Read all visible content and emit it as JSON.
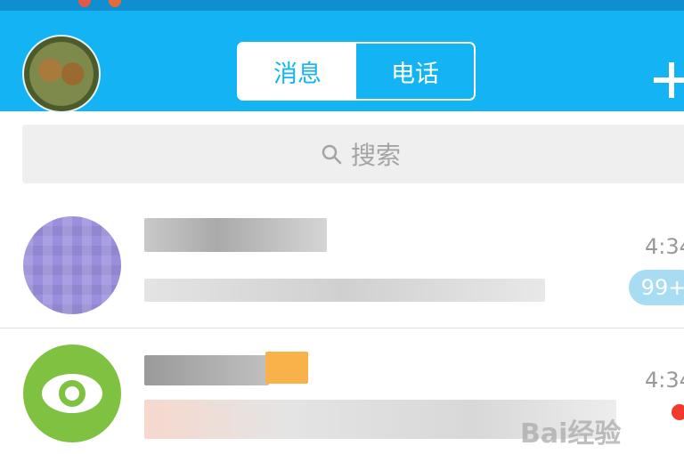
{
  "header": {
    "tabs": [
      {
        "label": "消息",
        "active": true
      },
      {
        "label": "电话",
        "active": false
      }
    ],
    "add_icon": "plus-icon",
    "background_color": "#14b4f4"
  },
  "search": {
    "placeholder": "搜索",
    "icon": "search-icon"
  },
  "conversations": [
    {
      "time": "4:34",
      "badge": "99+",
      "avatar_icon": "pixelated-avatar"
    },
    {
      "time": "4:34",
      "badge_dot": true,
      "avatar_icon": "eye-icon",
      "avatar_color": "#7fc241"
    }
  ],
  "watermark": "Bai经验"
}
